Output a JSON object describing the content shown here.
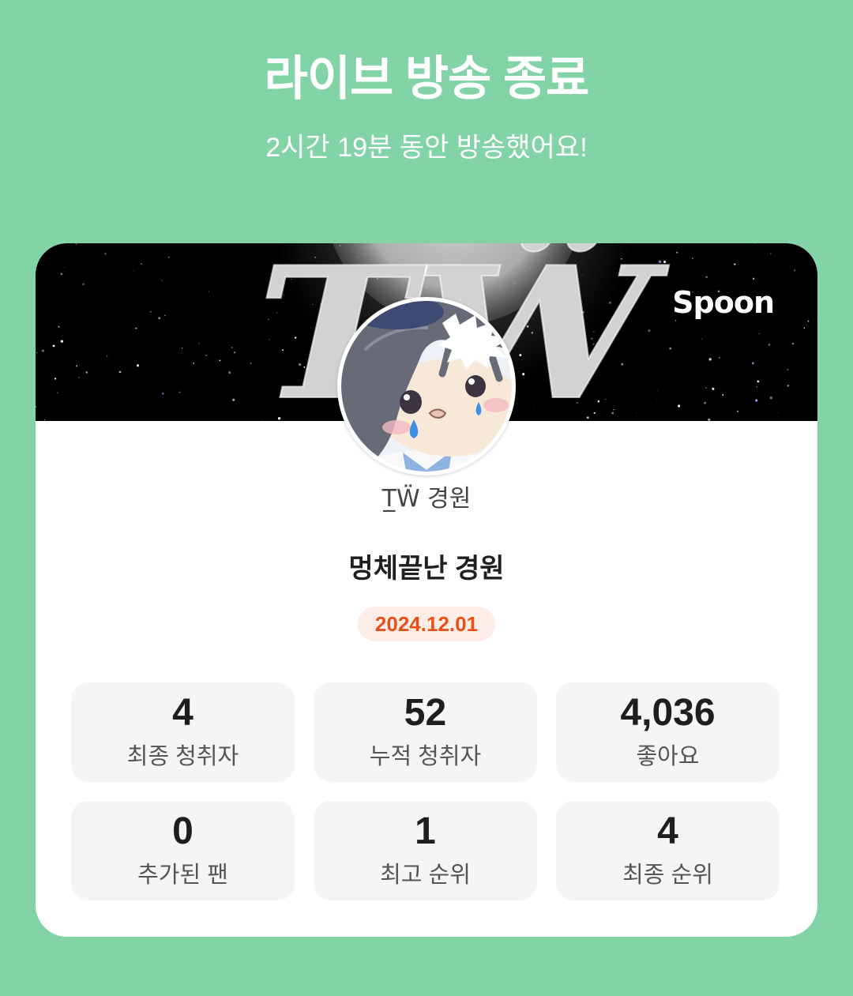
{
  "header": {
    "title": "라이브 방송 종료",
    "subtitle": "2시간 19분 동안 방송했어요!"
  },
  "banner": {
    "logo": "Spoon",
    "artwork_text": "TẄ"
  },
  "host": {
    "name": "T̲Ẅ 경원"
  },
  "broadcast": {
    "title": "멍체끝난 경원",
    "date": "2024.12.01"
  },
  "stats": [
    {
      "value": "4",
      "label": "최종 청취자"
    },
    {
      "value": "52",
      "label": "누적 청취자"
    },
    {
      "value": "4,036",
      "label": "좋아요"
    },
    {
      "value": "0",
      "label": "추가된 팬"
    },
    {
      "value": "1",
      "label": "최고 순위"
    },
    {
      "value": "4",
      "label": "최종 순위"
    }
  ],
  "icons": {
    "banner": "starry-night-moon-artwork",
    "avatar": "cartoon-crying-boy-avatar"
  },
  "colors": {
    "background": "#82D4A7",
    "card": "#FFFFFF",
    "banner": "#000000",
    "date_text": "#E8501A",
    "date_badge": "#FDEDE6",
    "stat_box": "#F5F5F5"
  }
}
